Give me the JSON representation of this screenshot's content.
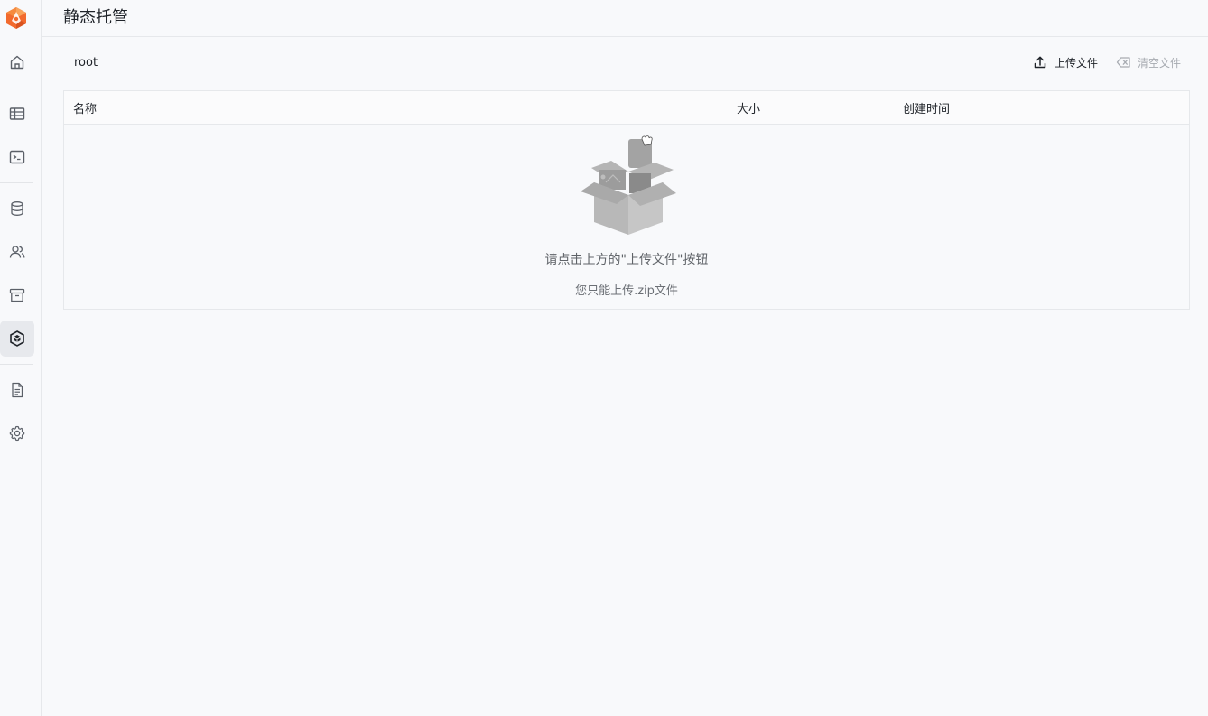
{
  "header": {
    "title": "静态托管"
  },
  "sidebar": {
    "items": [
      {
        "icon": "home-icon"
      },
      {
        "icon": "table-icon"
      },
      {
        "icon": "terminal-icon"
      },
      {
        "icon": "database-icon"
      },
      {
        "icon": "users-icon"
      },
      {
        "icon": "archive-icon"
      },
      {
        "icon": "hosting-icon",
        "active": true
      },
      {
        "icon": "document-icon"
      },
      {
        "icon": "gear-icon"
      }
    ]
  },
  "toolbar": {
    "path": "root",
    "upload_label": "上传文件",
    "clear_label": "清空文件"
  },
  "table": {
    "columns": [
      "名称",
      "大小",
      "创建时间"
    ],
    "rows": []
  },
  "empty_state": {
    "message": "请点击上方的\"上传文件\"按钮",
    "hint": "您只能上传.zip文件"
  },
  "colors": {
    "brand": "#f26a2e",
    "active_nav_bg": "#e7e9ed",
    "disabled_text": "#a7abb1"
  }
}
